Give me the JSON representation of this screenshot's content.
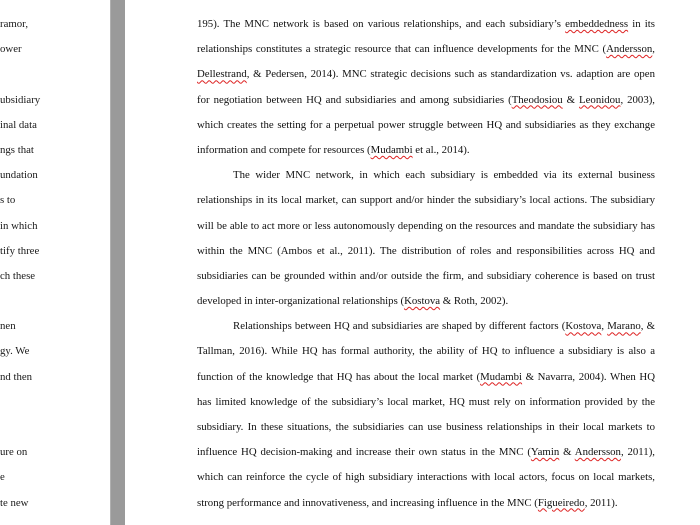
{
  "left_page": {
    "lines": [
      "ramor,",
      "ower",
      "",
      "ubsidiary",
      "inal data",
      "ngs that",
      "undation",
      "s to",
      "in which",
      "tify three",
      "ch these",
      "",
      "nen",
      "gy. We",
      "nd then",
      "",
      "",
      "ure on",
      "e",
      "te new"
    ]
  },
  "right_page": {
    "lines": [
      {
        "segments": [
          {
            "t": "195). The MNC network is based on various relationships, and each subsidiary’s "
          },
          {
            "t": "embeddedness",
            "sq": true
          },
          {
            "t": " in its"
          }
        ]
      },
      {
        "segments": [
          {
            "t": "relationships constitutes a strategic resource that can influence developments for the MNC ("
          },
          {
            "t": "Andersson",
            "sq": true
          },
          {
            "t": ","
          }
        ]
      },
      {
        "segments": [
          {
            "t": "Dellestrand",
            "sq": true
          },
          {
            "t": ", & Pedersen, 2014). MNC strategic decisions such as standardization vs. adaption are open"
          }
        ]
      },
      {
        "segments": [
          {
            "t": "for negotiation between HQ and subsidiaries and among subsidiaries ("
          },
          {
            "t": "Theodosiou",
            "sq": true
          },
          {
            "t": " & "
          },
          {
            "t": "Leonidou",
            "sq": true
          },
          {
            "t": ", 2003),"
          }
        ]
      },
      {
        "segments": [
          {
            "t": "which creates the setting for a perpetual power struggle between HQ and subsidiaries as they exchange"
          }
        ]
      },
      {
        "last": true,
        "segments": [
          {
            "t": "information and compete for resources ("
          },
          {
            "t": "Mudambi",
            "sq": true
          },
          {
            "t": " et al., 2014)."
          }
        ]
      },
      {
        "indent": true,
        "segments": [
          {
            "t": "The wider MNC network, in which each subsidiary is embedded via its external business"
          }
        ]
      },
      {
        "segments": [
          {
            "t": "relationships in its local market, can support and/or hinder the subsidiary’s local actions. The subsidiary"
          }
        ]
      },
      {
        "segments": [
          {
            "t": "will be able to act more or less autonomously depending on the resources and mandate the subsidiary has"
          }
        ]
      },
      {
        "segments": [
          {
            "t": "within the MNC (Ambos et al., 2011). The distribution of roles and responsibilities across HQ and"
          }
        ]
      },
      {
        "segments": [
          {
            "t": "subsidiaries can be grounded within and/or outside the firm, and subsidiary coherence is based on trust"
          }
        ]
      },
      {
        "last": true,
        "segments": [
          {
            "t": "developed in inter-organizational relationships ("
          },
          {
            "t": "Kostova",
            "sq": true
          },
          {
            "t": " & Roth, 2002)."
          }
        ]
      },
      {
        "indent": true,
        "segments": [
          {
            "t": "Relationships between HQ and subsidiaries are shaped by different factors ("
          },
          {
            "t": "Kostova",
            "sq": true
          },
          {
            "t": ", "
          },
          {
            "t": "Marano",
            "sq": true
          },
          {
            "t": ", &"
          }
        ]
      },
      {
        "segments": [
          {
            "t": "Tallman, 2016). While HQ has formal authority, the ability of HQ to influence a subsidiary is also a"
          }
        ]
      },
      {
        "segments": [
          {
            "t": "function of the knowledge that HQ has about the local market ("
          },
          {
            "t": "Mudambi",
            "sq": true
          },
          {
            "t": " & Navarra, 2004). When HQ"
          }
        ]
      },
      {
        "segments": [
          {
            "t": "has limited knowledge of the subsidiary’s local market, HQ must rely on information provided by the"
          }
        ]
      },
      {
        "segments": [
          {
            "t": "subsidiary. In these situations, the subsidiaries can use business relationships in their local markets to"
          }
        ]
      },
      {
        "segments": [
          {
            "t": "influence HQ decision-making and increase their own status in the MNC ("
          },
          {
            "t": "Yamin",
            "sq": true
          },
          {
            "t": " & "
          },
          {
            "t": "Andersson",
            "sq": true
          },
          {
            "t": ", 2011),"
          }
        ]
      },
      {
        "segments": [
          {
            "t": "which can reinforce the cycle of high subsidiary interactions with local actors, focus on local markets,"
          }
        ]
      },
      {
        "last": true,
        "segments": [
          {
            "t": "strong performance and innovativeness, and increasing influence in the MNC ("
          },
          {
            "t": "Figueiredo",
            "sq": true
          },
          {
            "t": ", 2011)."
          }
        ]
      }
    ]
  }
}
